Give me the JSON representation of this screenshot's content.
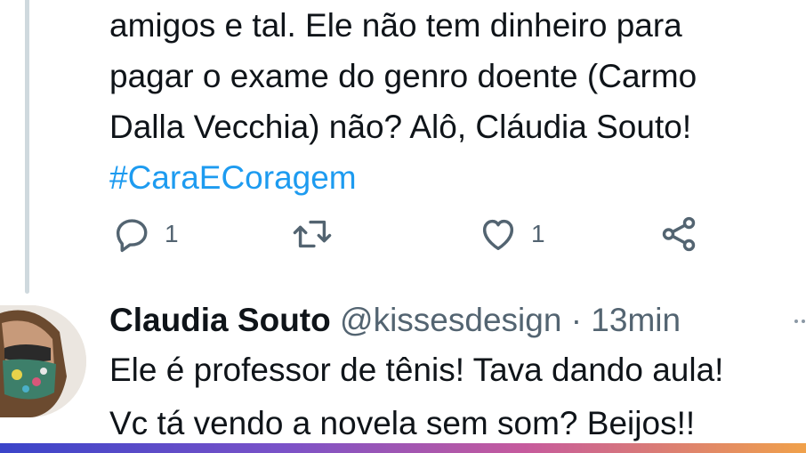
{
  "tweet": {
    "text_lines": [
      "amigos e tal. Ele não tem dinheiro para",
      "pagar o exame do genro doente (Carmo",
      "Dalla Vecchia) não? Alô, Cláudia Souto!"
    ],
    "hashtag": "#CaraECoragem",
    "actions": {
      "reply_count": "1",
      "like_count": "1"
    }
  },
  "reply": {
    "name": "Claudia Souto",
    "handle": "@kissesdesign",
    "separator": "·",
    "time": "13min",
    "text_lines": [
      "Ele é professor de tênis! Tava dando aula!",
      "Vc tá vendo a novela sem som? Beijos!!"
    ]
  },
  "icons": {
    "reply": "reply-icon",
    "retweet": "retweet-icon",
    "like": "heart-icon",
    "share": "share-icon",
    "more": "more-icon"
  },
  "colors": {
    "text": "#0f1419",
    "secondary": "#536471",
    "link": "#1d9bf0",
    "thread_line": "#cfd9de"
  }
}
